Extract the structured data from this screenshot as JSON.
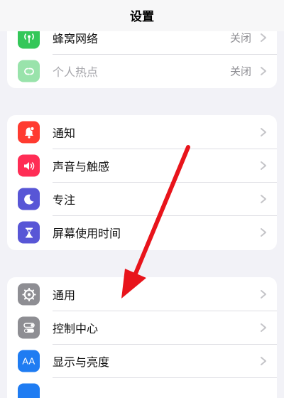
{
  "nav": {
    "title": "设置"
  },
  "group1": [
    {
      "label": "蜂窝网络",
      "value": "关闭",
      "icon": "cellular-antenna-icon",
      "color": "#34c759"
    },
    {
      "label": "个人热点",
      "value": "关闭",
      "icon": "personal-hotspot-link-icon",
      "color": "#34c759"
    }
  ],
  "group2": [
    {
      "label": "通知",
      "icon": "notification-bell-icon",
      "color": "#ff3b30"
    },
    {
      "label": "声音与触感",
      "icon": "speaker-icon",
      "color": "#ff2d55"
    },
    {
      "label": "专注",
      "icon": "moon-icon",
      "color": "#5856d6"
    },
    {
      "label": "屏幕使用时间",
      "icon": "hourglass-icon",
      "color": "#5856d6"
    }
  ],
  "group3": [
    {
      "label": "通用",
      "icon": "gear-icon",
      "color": "#8e8e93"
    },
    {
      "label": "控制中心",
      "icon": "toggle-switches-icon",
      "color": "#8e8e93"
    },
    {
      "label": "显示与亮度",
      "icon": "text-size-aa-icon",
      "color": "#1f7cf2"
    }
  ],
  "icon_text": {
    "aa": "AA"
  },
  "annotation": {
    "arrow_color": "#e8141b"
  }
}
